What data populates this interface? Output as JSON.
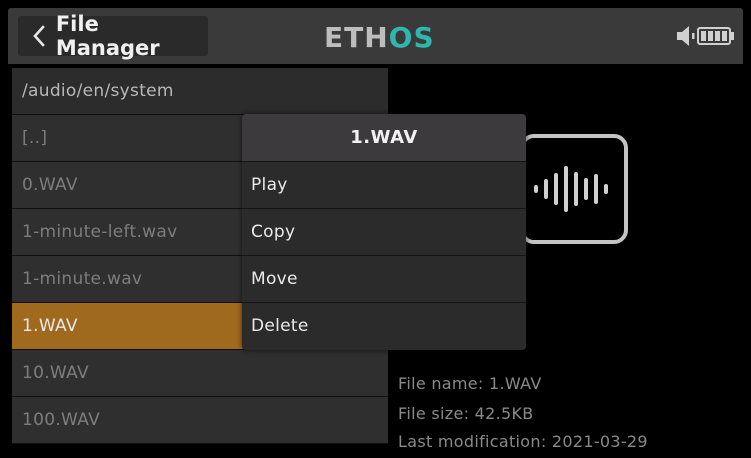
{
  "header": {
    "title": "File Manager",
    "logo_part1": "ETH",
    "logo_part2": "OS",
    "accent_color": "#2fb7ae"
  },
  "file_list": {
    "path": "/audio/en/system",
    "items": [
      {
        "label": "[..]",
        "selected": false
      },
      {
        "label": "0.WAV",
        "selected": false
      },
      {
        "label": "1-minute-left.wav",
        "selected": false
      },
      {
        "label": "1-minute.wav",
        "selected": false
      },
      {
        "label": "1.WAV",
        "selected": true
      },
      {
        "label": "10.WAV",
        "selected": false
      },
      {
        "label": "100.WAV",
        "selected": false
      }
    ],
    "selected_color": "#a06a1e"
  },
  "file_info": {
    "name": "File name: 1.WAV",
    "size": "File size: 42.5KB",
    "modified": "Last modification: 2021-03-29"
  },
  "context_menu": {
    "title": "1.WAV",
    "items": [
      "Play",
      "Copy",
      "Move",
      "Delete"
    ]
  },
  "icons": {
    "back": "chevron-left-icon",
    "speaker": "speaker-icon",
    "battery": "battery-icon",
    "audio_file": "audio-waveform-icon"
  }
}
